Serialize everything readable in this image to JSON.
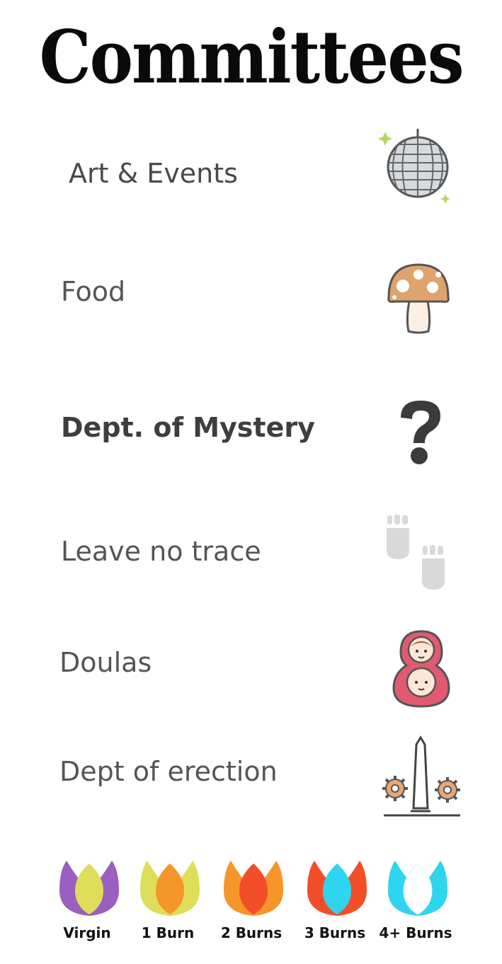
{
  "title": "Committees",
  "committees": [
    {
      "label": "Art & Events",
      "icon": "disco-ball-icon"
    },
    {
      "label": "Food",
      "icon": "mushroom-icon"
    },
    {
      "label": "Dept. of Mystery",
      "icon": "question-mark-icon"
    },
    {
      "label": "Leave no trace",
      "icon": "footprints-icon"
    },
    {
      "label": "Doulas",
      "icon": "nesting-doll-icon"
    },
    {
      "label": "Dept of erection",
      "icon": "obelisk-icon"
    }
  ],
  "legend": [
    {
      "label": "Virgin",
      "outer_color": "#9b5fc0",
      "inner_color": "#dede5a"
    },
    {
      "label": "1 Burn",
      "outer_color": "#dede5a",
      "inner_color": "#f5962a"
    },
    {
      "label": "2 Burns",
      "outer_color": "#f5962a",
      "inner_color": "#f24e2a"
    },
    {
      "label": "3 Burns",
      "outer_color": "#f24e2a",
      "inner_color": "#2fd4ef"
    },
    {
      "label": "4+ Burns",
      "outer_color": "#2fd4ef",
      "inner_color": "#ffffff"
    }
  ]
}
